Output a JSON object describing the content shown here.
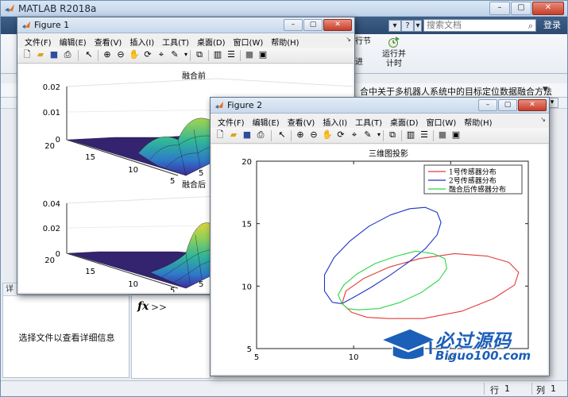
{
  "matlab": {
    "title": "MATLAB R2018a",
    "search_placeholder": "搜索文档",
    "login_label": "登录",
    "toolstrip": {
      "run_section_line1": "行节",
      "run_section_line2": "进",
      "run_time_line1": "运行并",
      "run_time_line2": "计时"
    },
    "current_doc": "合中关于多机器人系统中的目标定位数据融合方法",
    "details_panel": {
      "message": "选择文件以查看详细信息",
      "head": "详"
    },
    "command": {
      "fx": "fx",
      "prompt": ">>"
    },
    "statusbar": {
      "row_label": "行",
      "row_value": "1",
      "col_label": "列",
      "col_value": "1"
    }
  },
  "figure1": {
    "title": "Figure 1",
    "menu": [
      "文件(F)",
      "编辑(E)",
      "查看(V)",
      "插入(I)",
      "工具(T)",
      "桌面(D)",
      "窗口(W)",
      "帮助(H)"
    ],
    "plot_top": {
      "title": "融合前",
      "z_ticks": [
        "0",
        "0.01",
        "0.02"
      ],
      "y_ticks": [
        "20",
        "15",
        "10"
      ],
      "x_ticks": [
        "5",
        "5"
      ]
    },
    "plot_bottom": {
      "title": "融合后",
      "z_ticks": [
        "0",
        "0.02",
        "0.04"
      ],
      "y_ticks": [
        "20",
        "15",
        "10"
      ],
      "x_ticks": [
        "5",
        "5"
      ]
    }
  },
  "figure2": {
    "title": "Figure 2",
    "menu": [
      "文件(F)",
      "编辑(E)",
      "查看(V)",
      "插入(I)",
      "工具(T)",
      "桌面(D)",
      "窗口(W)",
      "帮助(H)"
    ]
  },
  "chart_data": {
    "type": "line",
    "title": "三维图投影",
    "xlabel": "",
    "ylabel": "",
    "xlim": [
      5,
      19
    ],
    "ylim": [
      5,
      20
    ],
    "x_ticks": [
      5,
      10,
      15
    ],
    "y_ticks": [
      5,
      10,
      15,
      20
    ],
    "legend_position": "top-right",
    "series": [
      {
        "name": "1号传感器分布",
        "color": "#e33b3b",
        "shape": "ellipse",
        "points": [
          [
            11.8,
            7.4
          ],
          [
            13.6,
            7.4
          ],
          [
            15.6,
            8.0
          ],
          [
            17.2,
            9.0
          ],
          [
            18.3,
            10.1
          ],
          [
            18.5,
            11.1
          ],
          [
            18.0,
            11.9
          ],
          [
            16.9,
            12.4
          ],
          [
            15.2,
            12.6
          ],
          [
            13.4,
            12.2
          ],
          [
            11.8,
            11.5
          ],
          [
            10.5,
            10.6
          ],
          [
            9.6,
            9.6
          ],
          [
            9.4,
            8.6
          ],
          [
            9.9,
            7.9
          ],
          [
            10.7,
            7.5
          ],
          [
            11.8,
            7.4
          ]
        ]
      },
      {
        "name": "2号传感器分布",
        "color": "#1f33c8",
        "shape": "ellipse",
        "points": [
          [
            8.9,
            8.7
          ],
          [
            8.5,
            9.6
          ],
          [
            8.5,
            10.9
          ],
          [
            9.0,
            12.3
          ],
          [
            9.8,
            13.6
          ],
          [
            10.8,
            14.8
          ],
          [
            11.9,
            15.7
          ],
          [
            12.9,
            16.2
          ],
          [
            13.7,
            16.3
          ],
          [
            14.3,
            15.9
          ],
          [
            14.5,
            15.1
          ],
          [
            14.3,
            14.1
          ],
          [
            13.7,
            13.0
          ],
          [
            12.9,
            12.0
          ],
          [
            11.9,
            10.9
          ],
          [
            10.9,
            9.9
          ],
          [
            10.0,
            9.1
          ],
          [
            9.4,
            8.6
          ],
          [
            8.9,
            8.7
          ]
        ]
      },
      {
        "name": "融合后传感器分布",
        "color": "#2fd447",
        "shape": "ellipse",
        "points": [
          [
            10.2,
            8.1
          ],
          [
            11.3,
            8.2
          ],
          [
            12.4,
            8.7
          ],
          [
            13.5,
            9.5
          ],
          [
            14.4,
            10.5
          ],
          [
            14.8,
            11.4
          ],
          [
            14.7,
            12.2
          ],
          [
            14.1,
            12.6
          ],
          [
            13.2,
            12.8
          ],
          [
            12.2,
            12.4
          ],
          [
            11.1,
            11.8
          ],
          [
            10.2,
            11.0
          ],
          [
            9.5,
            10.1
          ],
          [
            9.2,
            9.3
          ],
          [
            9.4,
            8.6
          ],
          [
            9.7,
            8.2
          ],
          [
            10.2,
            8.1
          ]
        ]
      }
    ]
  },
  "watermark": {
    "text": "必过源码",
    "url": "Biguo100.com"
  }
}
